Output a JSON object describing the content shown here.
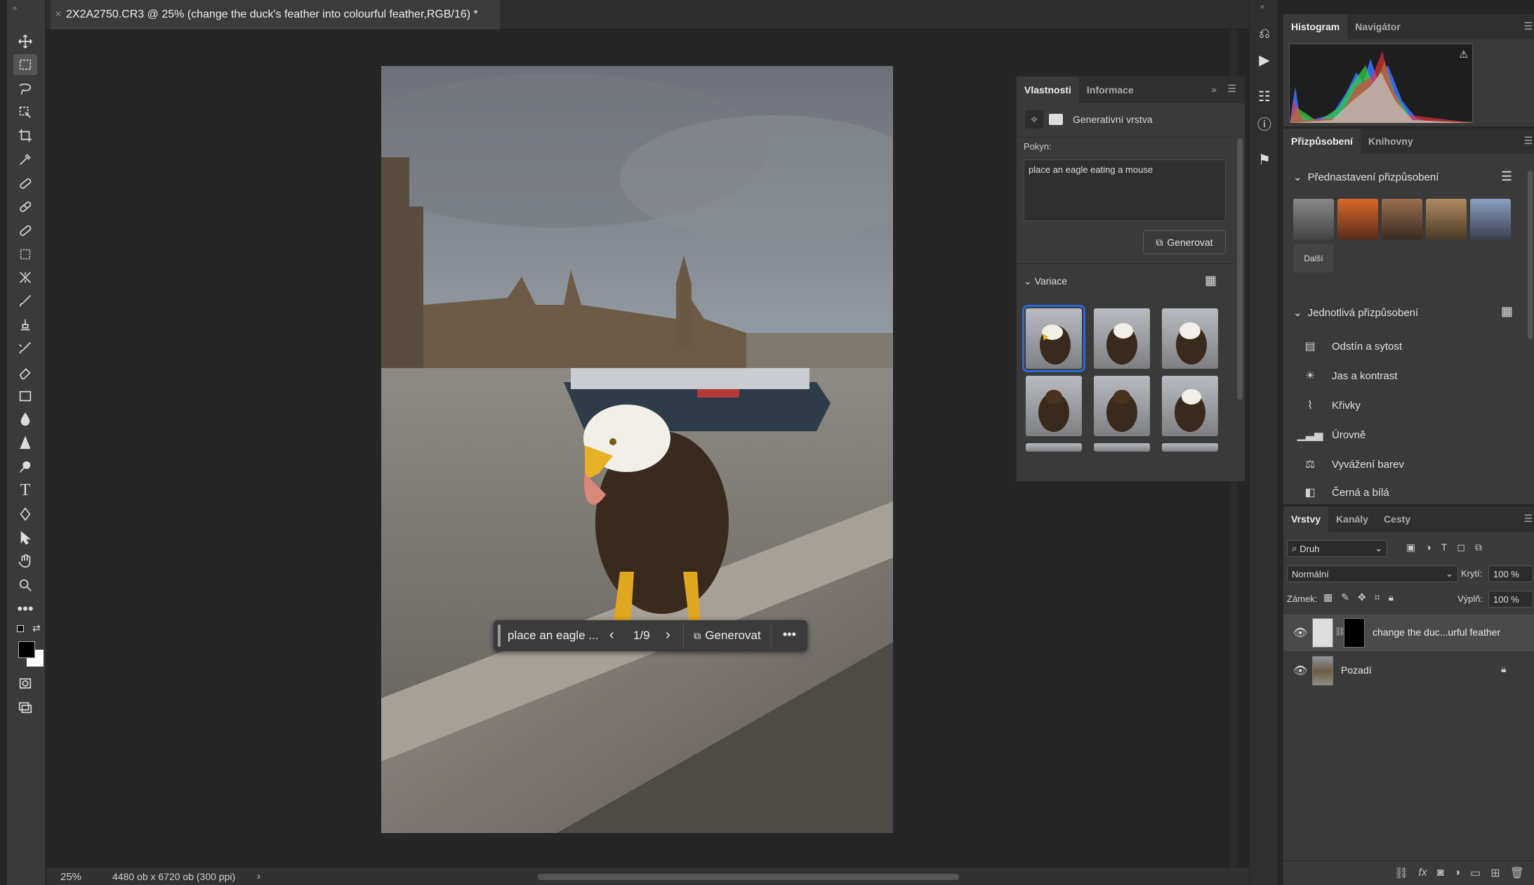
{
  "document": {
    "tab_title": "2X2A2750.CR3 @ 25% (change the duck's feather into colourful feather,RGB/16) *",
    "zoom": "25%",
    "doc_info": "4480 ob x 6720 ob (300 ppi)"
  },
  "context_bar": {
    "prompt_preview": "place an eagle ...",
    "counter": "1/9",
    "generate_label": "Generovat",
    "more_icon": "more-icon"
  },
  "properties": {
    "tabs": [
      "Vlastnosti",
      "Informace"
    ],
    "layer_type": "Generativní vrstva",
    "prompt_label": "Pokyn:",
    "prompt_value": "place an eagle eating a mouse",
    "generate_label": "Generovat",
    "variations_label": "Variace"
  },
  "histogram_panel": {
    "tabs": [
      "Histogram",
      "Navigátor"
    ]
  },
  "adjustments_panel": {
    "tabs": [
      "Přizpůsobení",
      "Knihovny"
    ],
    "presets_header": "Přednastavení přizpůsobení",
    "more_label": "Další",
    "individual_header": "Jednotlivá přizpůsobení",
    "items": [
      {
        "label": "Odstín a sytost",
        "icon": "hue-saturation-icon"
      },
      {
        "label": "Jas a kontrast",
        "icon": "brightness-contrast-icon"
      },
      {
        "label": "Křivky",
        "icon": "curves-icon"
      },
      {
        "label": "Úrovně",
        "icon": "levels-icon"
      },
      {
        "label": "Vyvážení barev",
        "icon": "color-balance-icon"
      },
      {
        "label": "Černá a bílá",
        "icon": "black-white-icon"
      }
    ]
  },
  "layers_panel": {
    "tabs": [
      "Vrstvy",
      "Kanály",
      "Cesty"
    ],
    "filter_kind": "Druh",
    "blend_mode": "Normální",
    "opacity_label": "Krytí:",
    "opacity_value": "100 %",
    "lock_label": "Zámek:",
    "fill_label": "Výplň:",
    "fill_value": "100 %",
    "layers": [
      {
        "name": "change the duc...urful feather"
      },
      {
        "name": "Pozadí"
      }
    ]
  },
  "colors": {
    "accent": "#2a6ad8",
    "panel_bg": "#3a3a3a",
    "app_bg": "#262626"
  }
}
